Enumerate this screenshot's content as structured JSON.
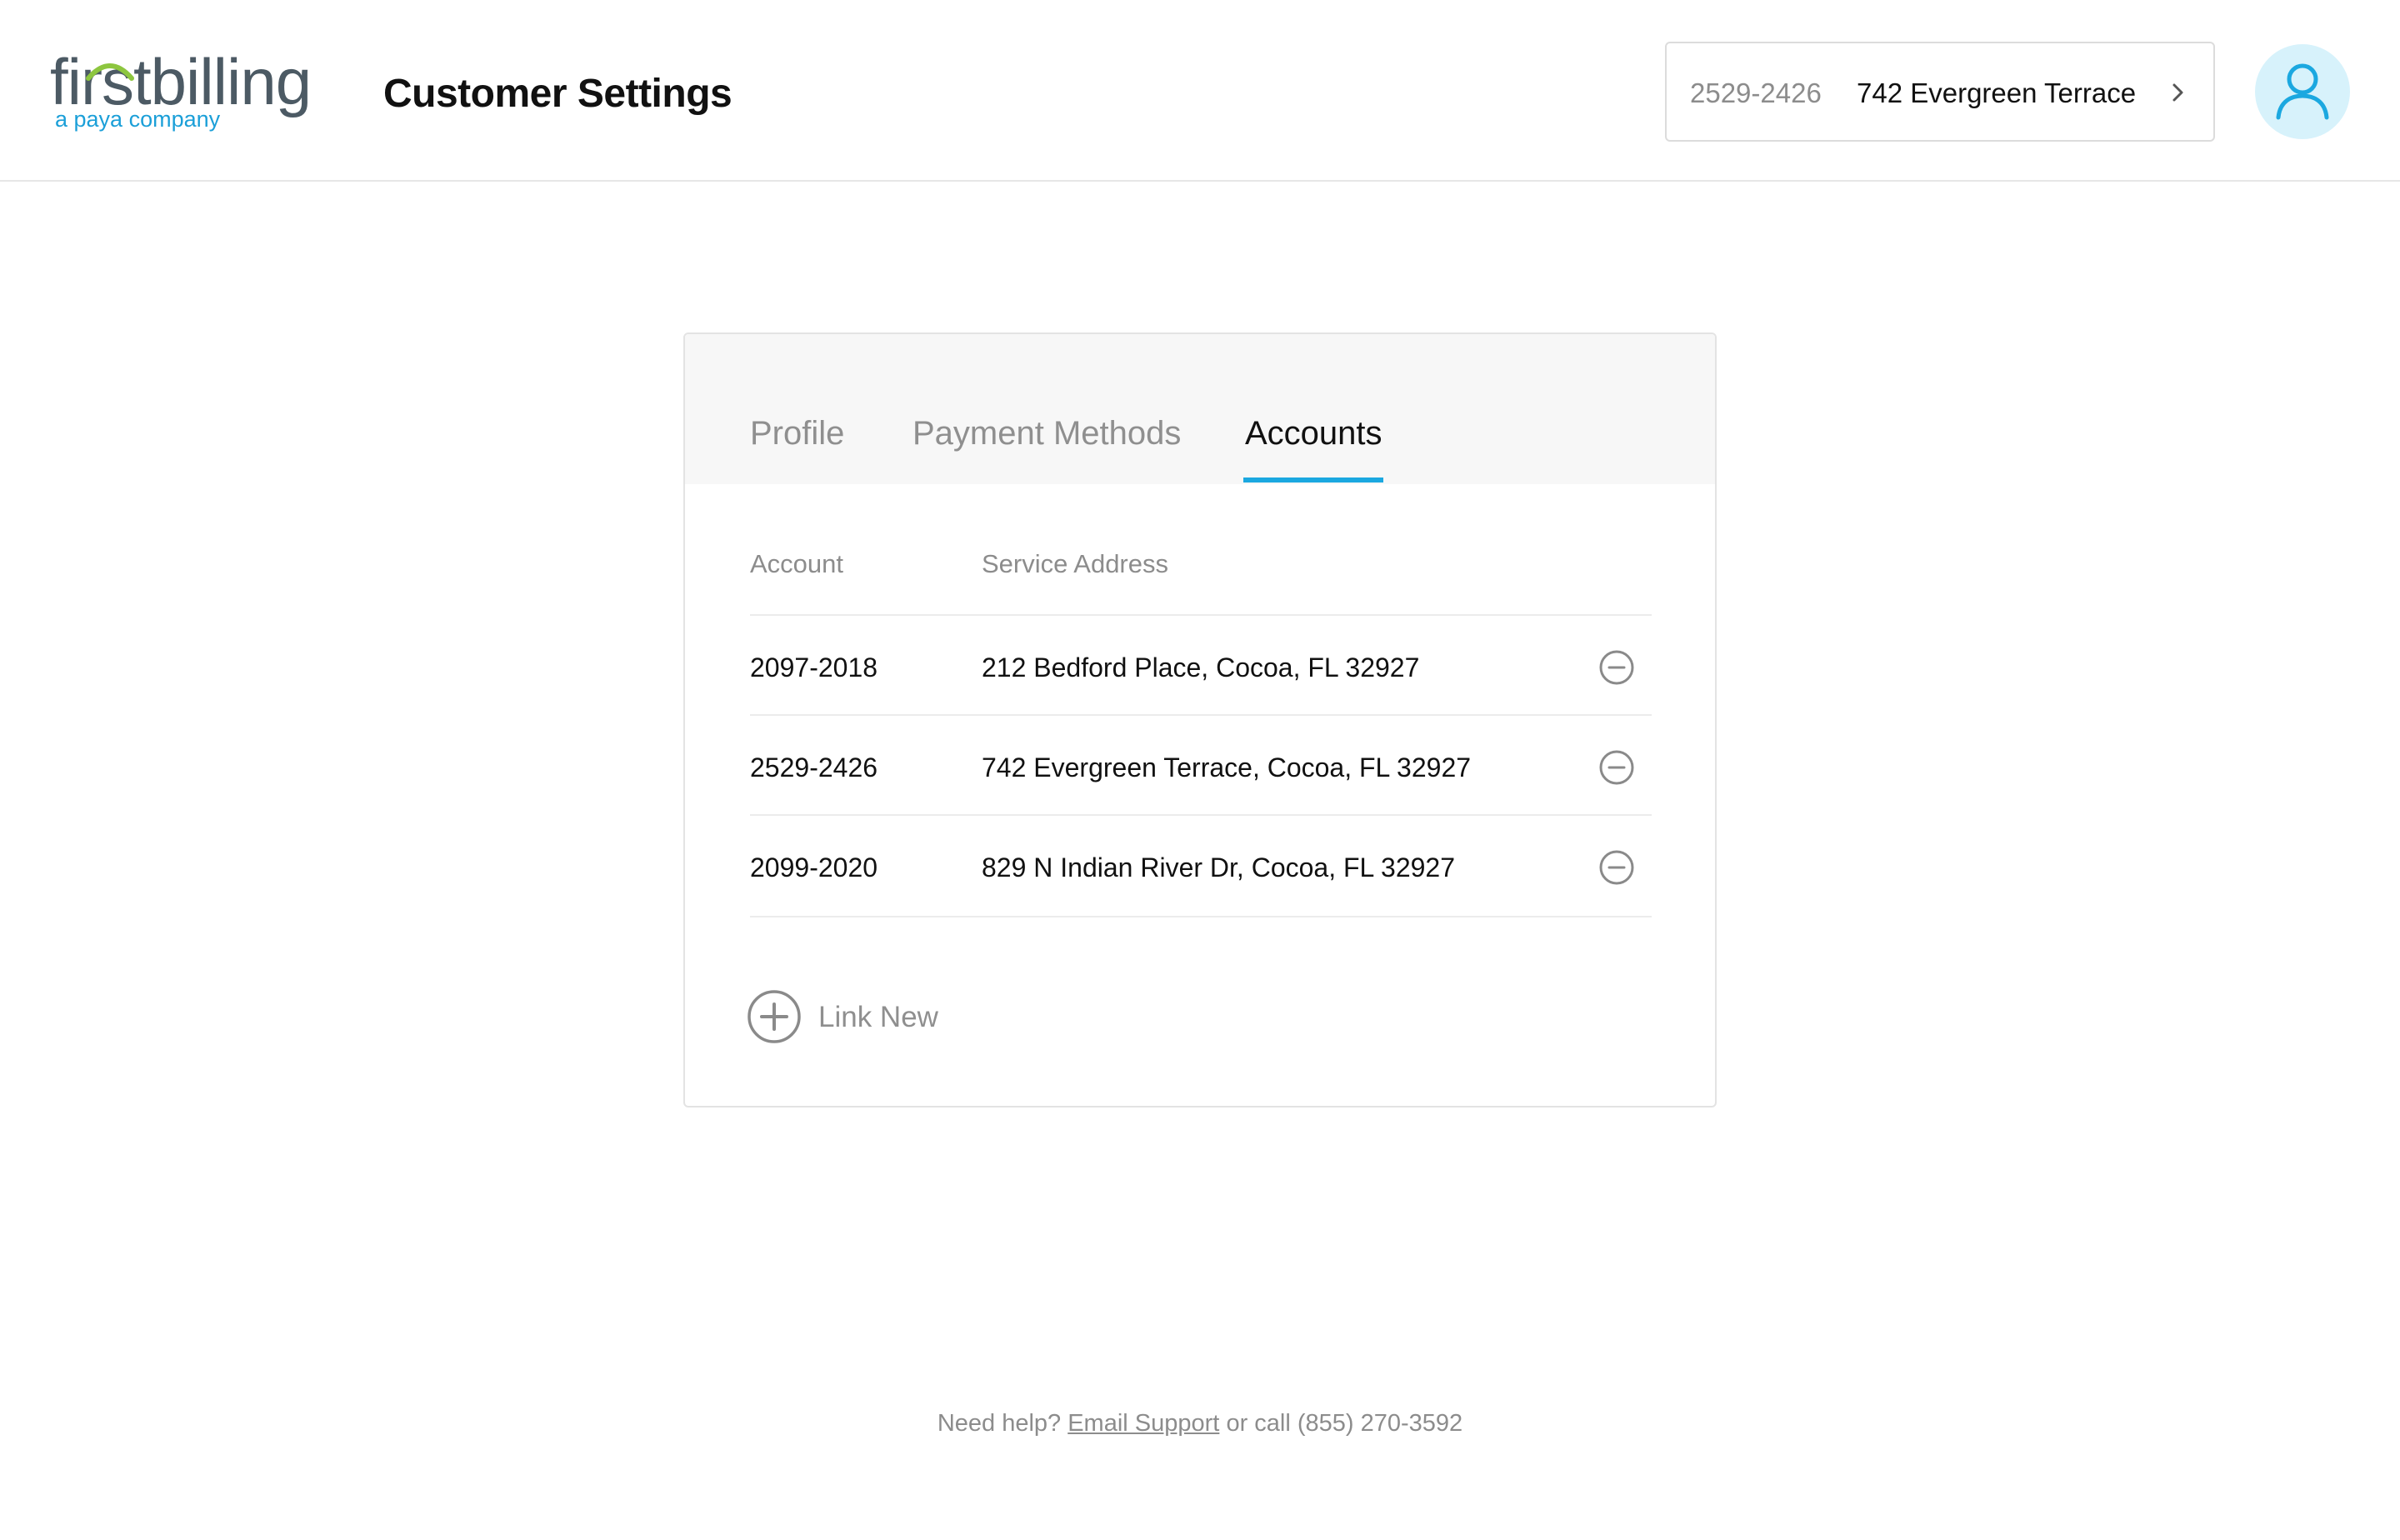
{
  "header": {
    "logo": {
      "wordmark": "firstbilling",
      "tagline": "a paya company",
      "wordmark_color": "#4c5a64",
      "accent_color": "#8dc63f",
      "tagline_color": "#1b9fd8"
    },
    "title": "Customer Settings",
    "account_switcher": {
      "account_number": "2529-2426",
      "address": "742 Evergreen Terrace",
      "icon": "chevron-right-icon"
    },
    "avatar": {
      "icon": "user-icon",
      "background": "#d7f2fb",
      "color": "#1ba8e0"
    }
  },
  "tabs": [
    {
      "label": "Profile",
      "active": false
    },
    {
      "label": "Payment Methods",
      "active": false
    },
    {
      "label": "Accounts",
      "active": true
    }
  ],
  "accounts_table": {
    "columns": [
      "Account",
      "Service Address"
    ],
    "rows": [
      {
        "account": "2097-2018",
        "address": "212 Bedford Place, Cocoa, FL 32927",
        "action_icon": "remove-circle-icon"
      },
      {
        "account": "2529-2426",
        "address": "742 Evergreen Terrace, Cocoa, FL 32927",
        "action_icon": "remove-circle-icon"
      },
      {
        "account": "2099-2020",
        "address": "829 N Indian River Dr, Cocoa, FL 32927",
        "action_icon": "remove-circle-icon"
      }
    ]
  },
  "link_new": {
    "label": "Link New",
    "icon": "add-circle-icon"
  },
  "footer": {
    "prefix": "Need help?",
    "email_link": "Email Support",
    "suffix": "or call (855) 270-3592"
  },
  "colors": {
    "accent": "#1ba8e0",
    "muted_text": "#8c8c8c",
    "tab_bar_bg": "#f7f7f7"
  }
}
